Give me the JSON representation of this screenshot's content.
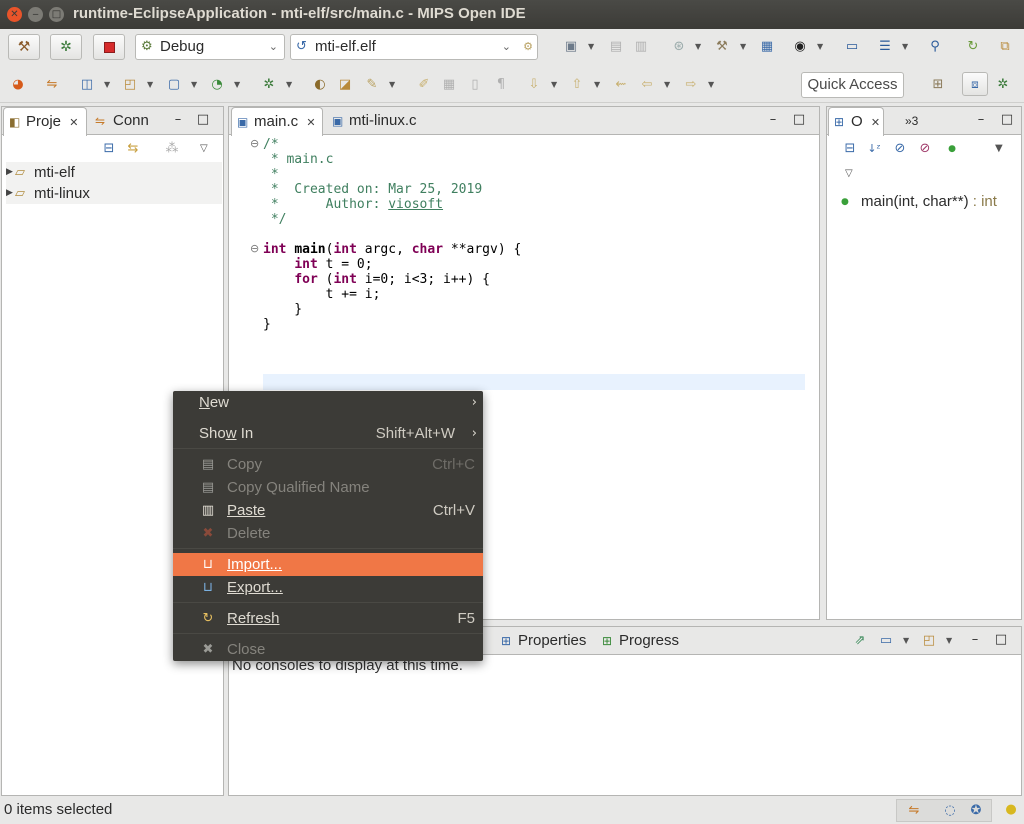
{
  "window": {
    "title": "runtime-EclipseApplication - mti-elf/src/main.c - MIPS Open IDE",
    "close_glyph": "✕",
    "min_glyph": "‒",
    "max_glyph": "□"
  },
  "toolbar": {
    "build_icon": "hammer-icon",
    "debug_icon": "bug-icon",
    "stop_icon": "stop-icon",
    "launch_mode": "Debug",
    "launch_target": "mti-elf.elf",
    "quick_access": "Quick Access"
  },
  "project_explorer": {
    "tabs": [
      {
        "label": "Proje",
        "active": true
      },
      {
        "label": "Conn",
        "active": false
      }
    ],
    "projects": [
      {
        "name": "mti-elf"
      },
      {
        "name": "mti-linux"
      }
    ]
  },
  "editor": {
    "tabs": [
      {
        "label": "main.c",
        "active": true
      },
      {
        "label": "mti-linux.c",
        "active": false
      }
    ]
  },
  "outline": {
    "tabs": [
      {
        "label": "O",
        "active": true
      },
      {
        "label": "»3",
        "active": false
      }
    ],
    "items": [
      {
        "name": "main(int, char**)",
        "type": ": int"
      }
    ]
  },
  "console": {
    "tabs": [
      {
        "label": "Properties"
      },
      {
        "label": "Progress"
      }
    ],
    "message": "No consoles to display at this time."
  },
  "status": {
    "selection": "0 items selected"
  },
  "context_menu": {
    "items": [
      {
        "label": "New",
        "underline": "N",
        "rest": "ew",
        "submenu": true
      },
      {
        "label": "Show In",
        "pre": "Sho",
        "underline": "w",
        "rest": " In",
        "shortcut": "Shift+Alt+W",
        "submenu": true
      },
      {
        "label": "Copy",
        "shortcut": "Ctrl+C",
        "disabled": true
      },
      {
        "label": "Copy Qualified Name",
        "disabled": true
      },
      {
        "label": "Paste",
        "shortcut": "Ctrl+V"
      },
      {
        "label": "Delete",
        "disabled": true
      },
      {
        "label": "Import...",
        "highlighted": true
      },
      {
        "label": "Export..."
      },
      {
        "label": "Refresh",
        "shortcut": "F5"
      },
      {
        "label": "Close",
        "disabled": true
      }
    ]
  },
  "colors": {
    "menu_bg": "#3c3b37",
    "menu_highlight": "#f07746",
    "comment": "#3f7f5f",
    "keyword": "#7f0055"
  }
}
